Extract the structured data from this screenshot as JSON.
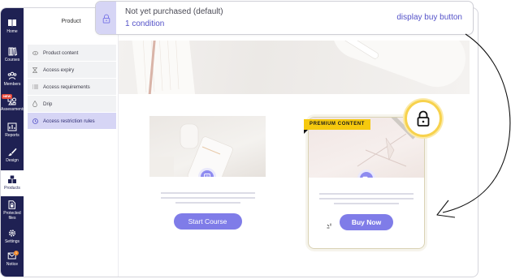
{
  "nav": {
    "items": [
      {
        "label": "Home",
        "icon": "book-icon"
      },
      {
        "label": "Courses",
        "icon": "courses-icon"
      },
      {
        "label": "Members",
        "icon": "members-icon"
      },
      {
        "label": "Assessments",
        "icon": "assessments-icon",
        "badge": "NEW"
      },
      {
        "label": "Reports",
        "icon": "reports-icon"
      },
      {
        "label": "Design",
        "icon": "brush-icon"
      },
      {
        "label": "Products",
        "icon": "products-icon"
      },
      {
        "label": "Protected files",
        "icon": "file-lock-icon"
      },
      {
        "label": "Settings",
        "icon": "gear-icon"
      },
      {
        "label": "Notice",
        "icon": "notice-icon",
        "count": "1"
      }
    ],
    "active": "Products",
    "bg_color": "#1f2153"
  },
  "subside": {
    "title": "Product",
    "menu": [
      {
        "label": "Product content",
        "icon": "eye-icon"
      },
      {
        "label": "Access expiry",
        "icon": "hourglass-icon"
      },
      {
        "label": "Access requirements",
        "icon": "list-icon"
      },
      {
        "label": "Drip",
        "icon": "drop-icon"
      },
      {
        "label": "Access restriction rules",
        "icon": "clock-icon"
      }
    ],
    "active": "Access restriction rules"
  },
  "popover": {
    "title": "Not yet purchased (default)",
    "subtitle": "1 condition",
    "action": "display buy button",
    "icon": "lock-icon",
    "accent": "#5452c8"
  },
  "cards": {
    "free": {
      "button": "Start Course",
      "icon": "document-icon"
    },
    "premium": {
      "badge": "PREMIUM CONTENT",
      "button": "Buy Now",
      "icon": "video-icon",
      "lock_icon": "lock-icon"
    }
  },
  "colors": {
    "primary": "#7f7ce8",
    "premium_badge": "#f6c90e",
    "highlight": "#d6d5f5"
  }
}
